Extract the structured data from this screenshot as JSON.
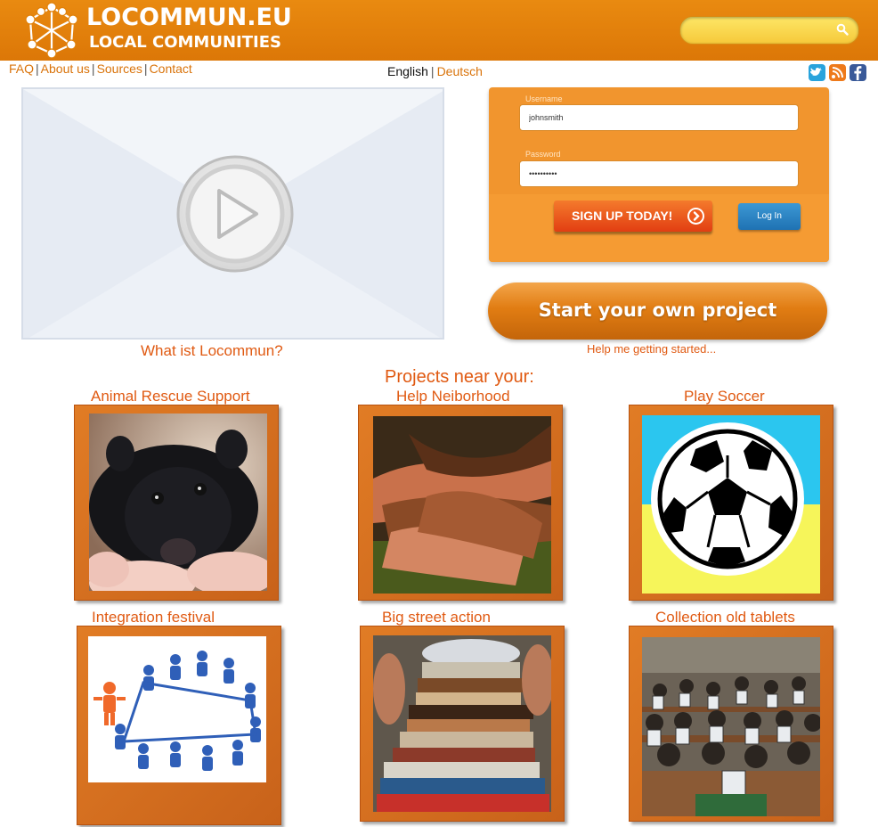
{
  "header": {
    "logo_title": "LOCOMMUN.EU",
    "logo_subtitle": "LOCAL COMMUNITIES",
    "search_placeholder": ""
  },
  "top_nav": {
    "items": [
      "FAQ",
      "About us",
      "Sources",
      "Contact"
    ]
  },
  "languages": {
    "current": "English",
    "other": "Deutsch"
  },
  "social": [
    "twitter-icon",
    "rss-icon",
    "facebook-icon"
  ],
  "video": {
    "caption": "What ist Locommun?"
  },
  "login": {
    "username_label": "Username",
    "username_value": "johnsmith",
    "password_label": "Password",
    "password_value": "••••••••••",
    "signup_label": "SIGN UP TODAY!",
    "login_label": "Log In"
  },
  "start_project": {
    "label": "Start your own project",
    "help_link": "Help me getting started..."
  },
  "projects": {
    "heading": "Projects near your:",
    "items": [
      {
        "title": "Animal Rescue Support"
      },
      {
        "title": "Help Neiborhood"
      },
      {
        "title": "Play Soccer"
      },
      {
        "title": "Integration festival"
      },
      {
        "title": "Big street action"
      },
      {
        "title": "Collection old tablets"
      }
    ]
  },
  "colors": {
    "brand_orange": "#e08008",
    "accent_text": "#e05a12",
    "link": "#d9730a",
    "login_blue": "#1f72b3"
  }
}
